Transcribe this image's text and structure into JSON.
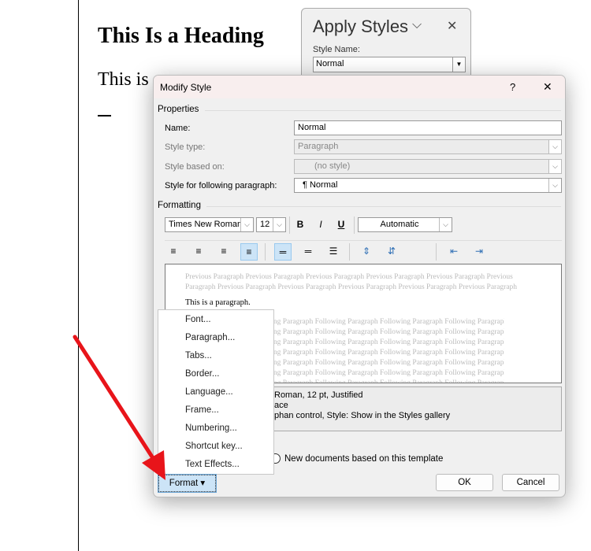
{
  "document": {
    "heading": "This Is a Heading",
    "paragraph": "This is"
  },
  "apply_styles": {
    "title": "Apply Styles",
    "style_name_label": "Style Name:",
    "style_name_value": "Normal"
  },
  "dialog": {
    "title": "Modify Style",
    "help": "?",
    "close": "✕",
    "properties_label": "Properties",
    "name_label": "Name:",
    "name_value": "Normal",
    "style_type_label": "Style type:",
    "style_type_value": "Paragraph",
    "based_on_label": "Style based on:",
    "based_on_value": "(no style)",
    "following_label": "Style for following paragraph:",
    "following_value": "¶  Normal",
    "formatting_label": "Formatting",
    "font": "Times New Roman",
    "size": "12",
    "bold": "B",
    "italic": "I",
    "underline": "U",
    "color": "Automatic",
    "preview_previous": "Previous Paragraph Previous Paragraph Previous Paragraph Previous Paragraph Previous Paragraph Previous Paragraph Previous Paragraph Previous Paragraph Previous Paragraph Previous Paragraph Previous Paragraph",
    "preview_sample": "This is a paragraph.",
    "preview_following": "Following Paragraph Following Paragraph Following Paragraph Following Paragraph Following Paragraph Following Paragraph",
    "description_lines": [
      "Roman, 12 pt, Justified",
      "ace",
      "phan control, Style: Show in the Styles gallery"
    ],
    "new_docs_label": "New documents based on this template",
    "format_button": "Format ▾",
    "ok": "OK",
    "cancel": "Cancel"
  },
  "format_menu": {
    "items": [
      "Font...",
      "Paragraph...",
      "Tabs...",
      "Border...",
      "Language...",
      "Frame...",
      "Numbering...",
      "Shortcut key...",
      "Text Effects..."
    ]
  },
  "annotation": {
    "arrow_color": "#e8141a"
  }
}
